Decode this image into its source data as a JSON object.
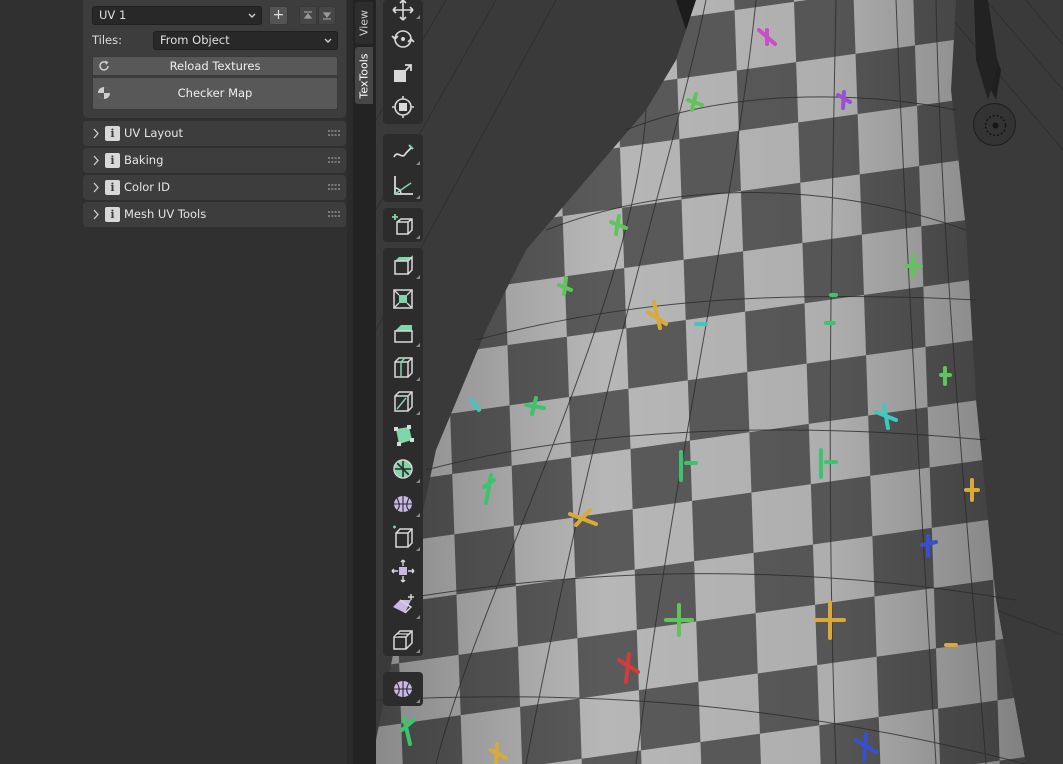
{
  "uv_panel": {
    "uv_map_value": "UV 1",
    "add_label": "+",
    "tiles_label": "Tiles:",
    "tiles_value": "From Object",
    "reload_label": "Reload Textures",
    "checker_label": "Checker Map"
  },
  "subpanels": [
    {
      "title": "UV Layout"
    },
    {
      "title": "Baking"
    },
    {
      "title": "Color ID"
    },
    {
      "title": "Mesh UV Tools"
    }
  ],
  "info_glyph": "i",
  "tabs": {
    "view": "View",
    "textools": "TexTools"
  },
  "tools": [
    {
      "icon": "move-icon"
    },
    {
      "icon": "rotate-icon"
    },
    {
      "icon": "scale-icon"
    },
    {
      "icon": "transform-icon"
    },
    {
      "icon": "annotate-icon"
    },
    {
      "icon": "measure-icon"
    },
    {
      "icon": "add-cube-icon"
    },
    {
      "icon": "extrude-region-icon"
    },
    {
      "icon": "inset-faces-icon"
    },
    {
      "icon": "bevel-icon"
    },
    {
      "icon": "loop-cut-icon"
    },
    {
      "icon": "knife-icon"
    },
    {
      "icon": "poly-build-icon"
    },
    {
      "icon": "spin-icon"
    },
    {
      "icon": "smooth-icon"
    },
    {
      "icon": "edge-slide-icon"
    },
    {
      "icon": "shrink-fatten-icon"
    },
    {
      "icon": "shear-icon"
    },
    {
      "icon": "rip-region-icon"
    },
    {
      "icon": "sphere-icon"
    }
  ],
  "colors": {
    "panel_bg": "#3d3d3d",
    "editor_bg": "#303030",
    "button": "#585858",
    "toolbar_icon": "#d9d9d9",
    "toolbar_accent": "#7fd6a8",
    "checker_light": "#b9b9b9",
    "checker_dark": "#555555"
  }
}
